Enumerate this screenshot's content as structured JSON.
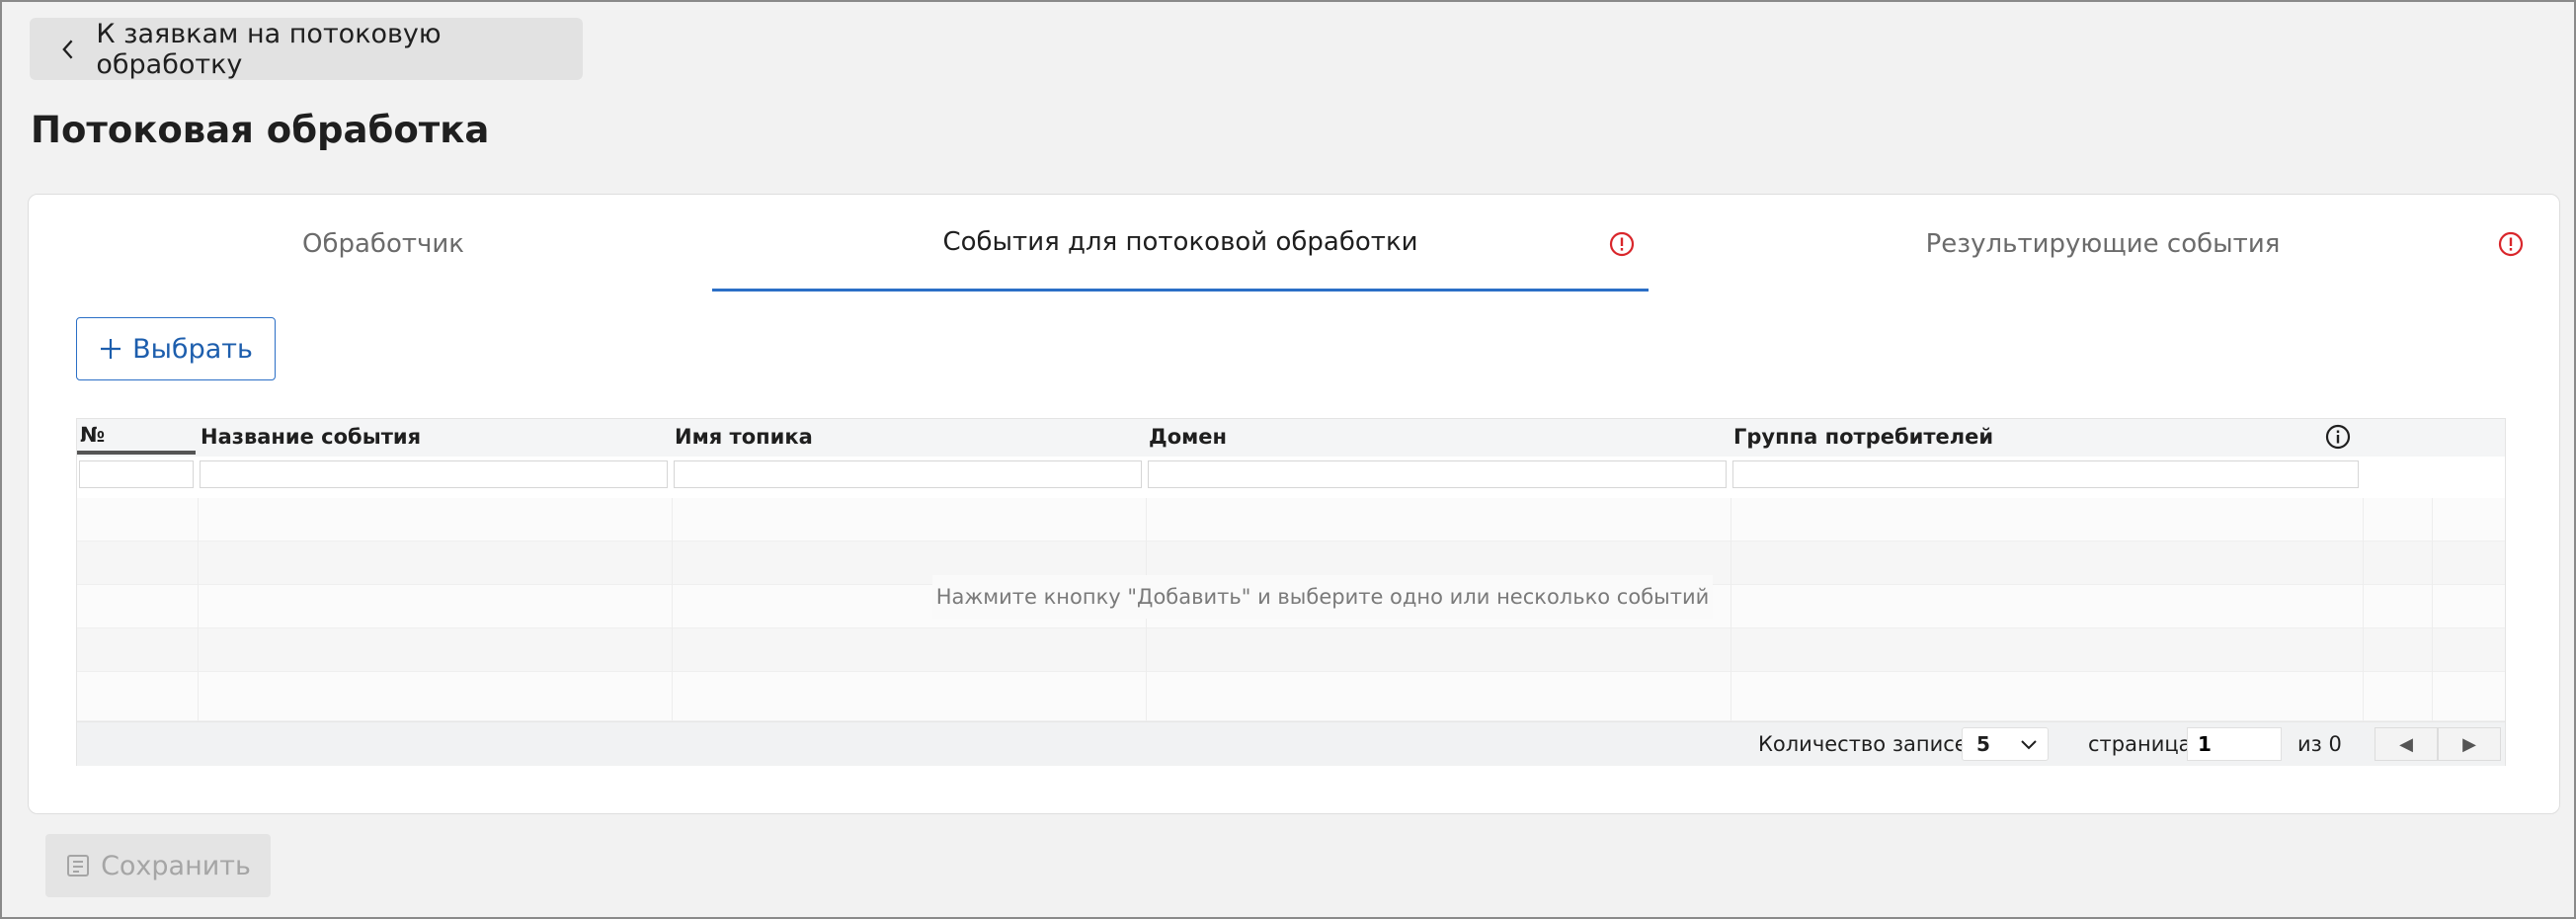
{
  "header": {
    "back_label": "К заявкам на потоковую обработку",
    "page_title": "Потоковая обработка"
  },
  "tabs": [
    {
      "label": "Обработчик",
      "active": false,
      "warning": false
    },
    {
      "label": "События для потоковой обработки",
      "active": true,
      "warning": true
    },
    {
      "label": "Результирующие события",
      "active": false,
      "warning": true
    }
  ],
  "toolbar": {
    "select_label": "Выбрать"
  },
  "table": {
    "columns": [
      "№",
      "Название события",
      "Имя топика",
      "Домен",
      "Группа потребителей"
    ],
    "rows": [],
    "empty_message": "Нажмите кнопку \"Добавить\" и выберите одно или несколько событий"
  },
  "pagination": {
    "records_label": "Количество записей",
    "page_size": "5",
    "page_label": "страница",
    "page_value": "1",
    "of_label": "из 0",
    "prev_glyph": "◀",
    "next_glyph": "▶"
  },
  "footer": {
    "save_label": "Сохранить"
  },
  "colors": {
    "accent": "#2b6fc6",
    "warning": "#d9262b",
    "disabled": "#a5a5a5"
  },
  "icons": [
    "chevron-left-icon",
    "warning-icon",
    "plus-icon",
    "info-icon",
    "chevron-down-icon",
    "save-icon"
  ]
}
